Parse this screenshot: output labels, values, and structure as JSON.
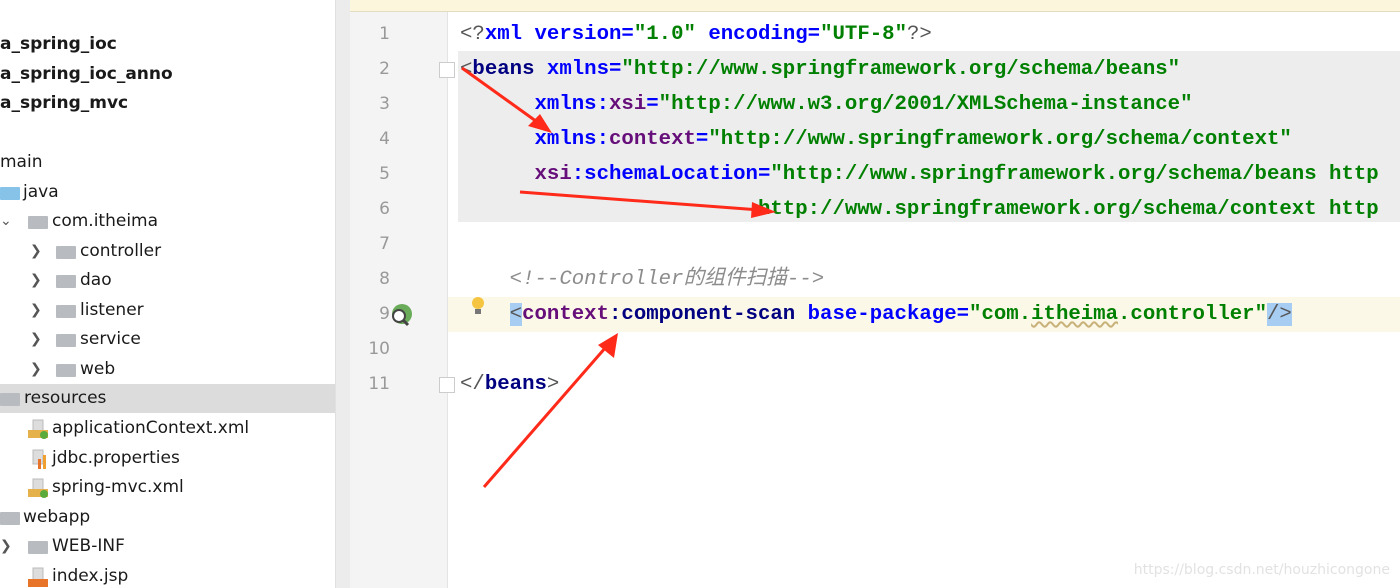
{
  "project_tree": {
    "items": [
      {
        "label": "a_spring_ioc",
        "bold": true
      },
      {
        "label": "a_spring_ioc_anno",
        "bold": true
      },
      {
        "label": "a_spring_mvc",
        "bold": true
      },
      {
        "label": "main"
      },
      {
        "label": "java",
        "icon": "source-folder-icon"
      },
      {
        "label": "com.itheima",
        "icon": "package-icon",
        "expanded": true
      },
      {
        "label": "controller",
        "icon": "package-icon"
      },
      {
        "label": "dao",
        "icon": "package-icon"
      },
      {
        "label": "listener",
        "icon": "package-icon"
      },
      {
        "label": "service",
        "icon": "package-icon"
      },
      {
        "label": "web",
        "icon": "package-icon"
      },
      {
        "label": "resources",
        "icon": "resources-folder-icon",
        "selected": true
      },
      {
        "label": "applicationContext.xml",
        "icon": "xml-file-icon"
      },
      {
        "label": "jdbc.properties",
        "icon": "properties-file-icon"
      },
      {
        "label": "spring-mvc.xml",
        "icon": "xml-file-icon"
      },
      {
        "label": "webapp",
        "icon": "web-folder-icon"
      },
      {
        "label": "WEB-INF",
        "icon": "folder-icon"
      },
      {
        "label": "index.jsp",
        "icon": "jsp-file-icon"
      }
    ]
  },
  "editor": {
    "line_numbers": [
      "1",
      "2",
      "3",
      "4",
      "5",
      "6",
      "7",
      "8",
      "9",
      "10",
      "11"
    ],
    "lines": [
      [
        [
          "<?",
          "br"
        ],
        [
          "xml ",
          "attr"
        ],
        [
          "version=",
          "attr"
        ],
        [
          "\"1.0\"",
          "str"
        ],
        [
          " encoding=",
          "attr"
        ],
        [
          "\"UTF-8\"",
          "str"
        ],
        [
          "?>",
          "br"
        ]
      ],
      [
        [
          "<",
          "br"
        ],
        [
          "beans ",
          "tag"
        ],
        [
          "xmlns=",
          "attr"
        ],
        [
          "\"http://www.springframework.org/schema/beans\"",
          "str"
        ]
      ],
      [
        [
          "      ",
          ""
        ],
        [
          "xmlns:",
          "attr"
        ],
        [
          "xsi",
          "ns"
        ],
        [
          "=",
          "attr"
        ],
        [
          "\"http://www.w3.org/2001/XMLSchema-instance\"",
          "str"
        ]
      ],
      [
        [
          "      ",
          ""
        ],
        [
          "xmlns:",
          "attr"
        ],
        [
          "context",
          "ns"
        ],
        [
          "=",
          "attr"
        ],
        [
          "\"http://www.springframework.org/schema/context\"",
          "str"
        ]
      ],
      [
        [
          "      ",
          ""
        ],
        [
          "xsi",
          "ns"
        ],
        [
          ":schemaLocation=",
          "attr"
        ],
        [
          "\"http://www.springframework.org/schema/beans http",
          "str"
        ]
      ],
      [
        [
          "                        ",
          ""
        ],
        [
          "http://www.springframework.org/schema/context http",
          "str"
        ]
      ],
      [],
      [
        [
          "    ",
          ""
        ],
        [
          "<!--Controller的组件扫描-->",
          "com"
        ]
      ],
      [
        [
          "    ",
          ""
        ],
        [
          "<",
          "sel"
        ],
        [
          "context",
          "ns"
        ],
        [
          ":component-scan ",
          "tag"
        ],
        [
          "base-package=",
          "attr"
        ],
        [
          "\"com.",
          "str"
        ],
        [
          "itheima",
          "warn"
        ],
        [
          ".controller\"",
          "str"
        ],
        [
          "/>",
          "sel"
        ]
      ],
      [],
      [
        [
          "</",
          "br"
        ],
        [
          "beans",
          "tag"
        ],
        [
          ">",
          "br"
        ]
      ]
    ],
    "gutter_icons": {
      "line9": "spring-bean-scan-icon",
      "line9_intention": "lightbulb-icon"
    },
    "annotation_color": "#ff2a1a"
  },
  "watermark": "https://blog.csdn.net/houzhicongone"
}
